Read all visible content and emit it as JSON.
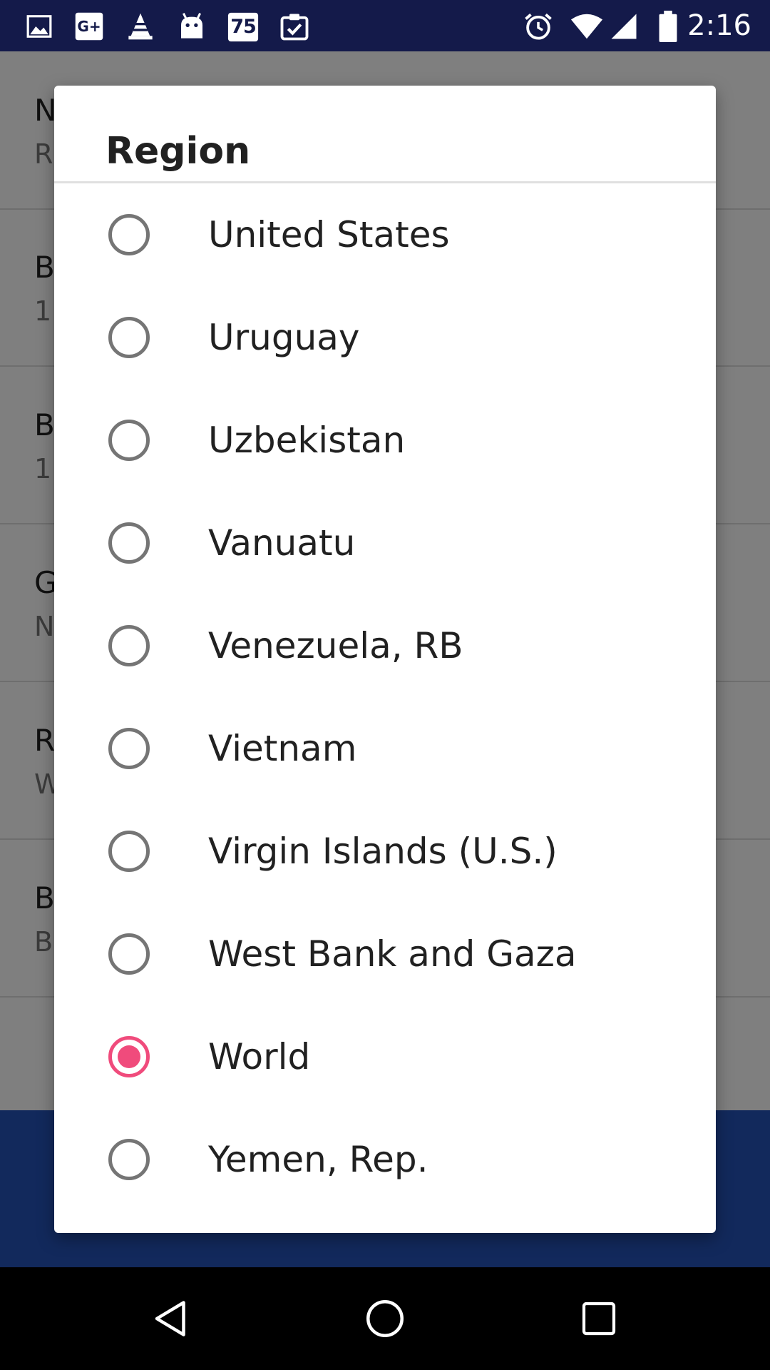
{
  "status_bar": {
    "time": "2:16",
    "notification_icons": [
      "image-icon",
      "google-plus-icon",
      "vlc-cone-icon",
      "android-head-icon",
      "calendar-icon",
      "checklist-icon"
    ],
    "calendar_day": "75",
    "google_plus_text": "G+",
    "system_icons": [
      "alarm-icon",
      "wifi-icon",
      "signal-icon",
      "battery-icon"
    ],
    "background_color": "#141a4a"
  },
  "background_screen": {
    "rows": [
      {
        "title": "N",
        "subtitle": "R"
      },
      {
        "title": "B",
        "subtitle": "1"
      },
      {
        "title": "B",
        "subtitle": "1"
      },
      {
        "title": "G",
        "subtitle": "N"
      },
      {
        "title": "R",
        "subtitle": "W"
      },
      {
        "title": "B",
        "subtitle": "B"
      }
    ],
    "footer_color": "#2552b8"
  },
  "dialog": {
    "title": "Region",
    "options": [
      {
        "label": "United States",
        "selected": false
      },
      {
        "label": "Uruguay",
        "selected": false
      },
      {
        "label": "Uzbekistan",
        "selected": false
      },
      {
        "label": "Vanuatu",
        "selected": false
      },
      {
        "label": "Venezuela, RB",
        "selected": false
      },
      {
        "label": "Vietnam",
        "selected": false
      },
      {
        "label": "Virgin Islands (U.S.)",
        "selected": false
      },
      {
        "label": "West Bank and Gaza",
        "selected": false
      },
      {
        "label": "World",
        "selected": true
      },
      {
        "label": "Yemen, Rep.",
        "selected": false
      }
    ],
    "accent_color": "#f04b7c"
  },
  "nav_bar": {
    "buttons": [
      "back-icon",
      "home-icon",
      "recents-icon"
    ]
  }
}
